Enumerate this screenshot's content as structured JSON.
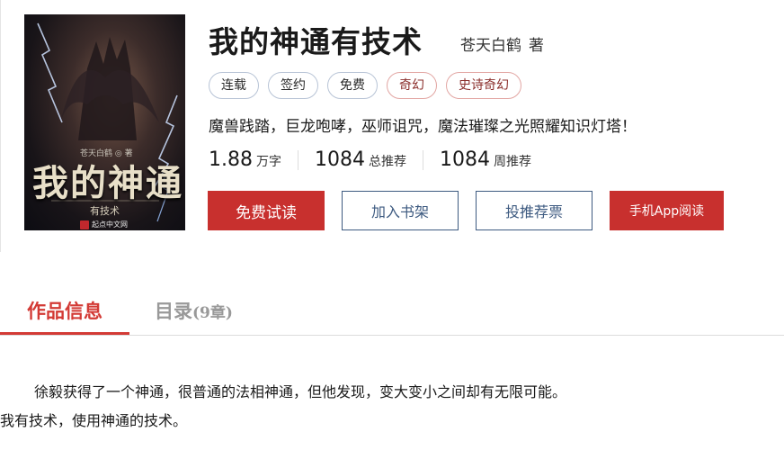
{
  "book": {
    "title": "我的神通有技术",
    "author": "苍天白鹤",
    "author_role": "著",
    "tags": [
      {
        "label": "连载",
        "style": "blue"
      },
      {
        "label": "签约",
        "style": "blue"
      },
      {
        "label": "免费",
        "style": "blue"
      },
      {
        "label": "奇幻",
        "style": "red"
      },
      {
        "label": "史诗奇幻",
        "style": "red"
      }
    ],
    "intro": "魔兽践踏，巨龙咆哮，巫师诅咒，魔法璀璨之光照耀知识灯塔！",
    "stats": [
      {
        "value": "1.88",
        "unit": "万字"
      },
      {
        "value": "1084",
        "unit": "总推荐"
      },
      {
        "value": "1084",
        "unit": "周推荐"
      }
    ]
  },
  "cover": {
    "title": "我的神通",
    "subtitle": "有技术",
    "author": "苍天白鹤 ◎ 著",
    "publisher": "起点中文网",
    "publisher_logo_text": "起"
  },
  "actions": {
    "read": "免费试读",
    "shelf": "加入书架",
    "vote": "投推荐票",
    "app": "手机App阅读"
  },
  "tabs": {
    "info": "作品信息",
    "toc": "目录",
    "toc_count": "(9章)"
  },
  "summary": [
    "徐毅获得了一个神通，很普通的法相神通，但他发现，变大变小之间却有无限可能。",
    "我有技术，使用神通的技术。"
  ],
  "colors": {
    "accent_red": "#c8302e",
    "tab_active": "#d33a35",
    "button_outline": "#3d5a80"
  }
}
